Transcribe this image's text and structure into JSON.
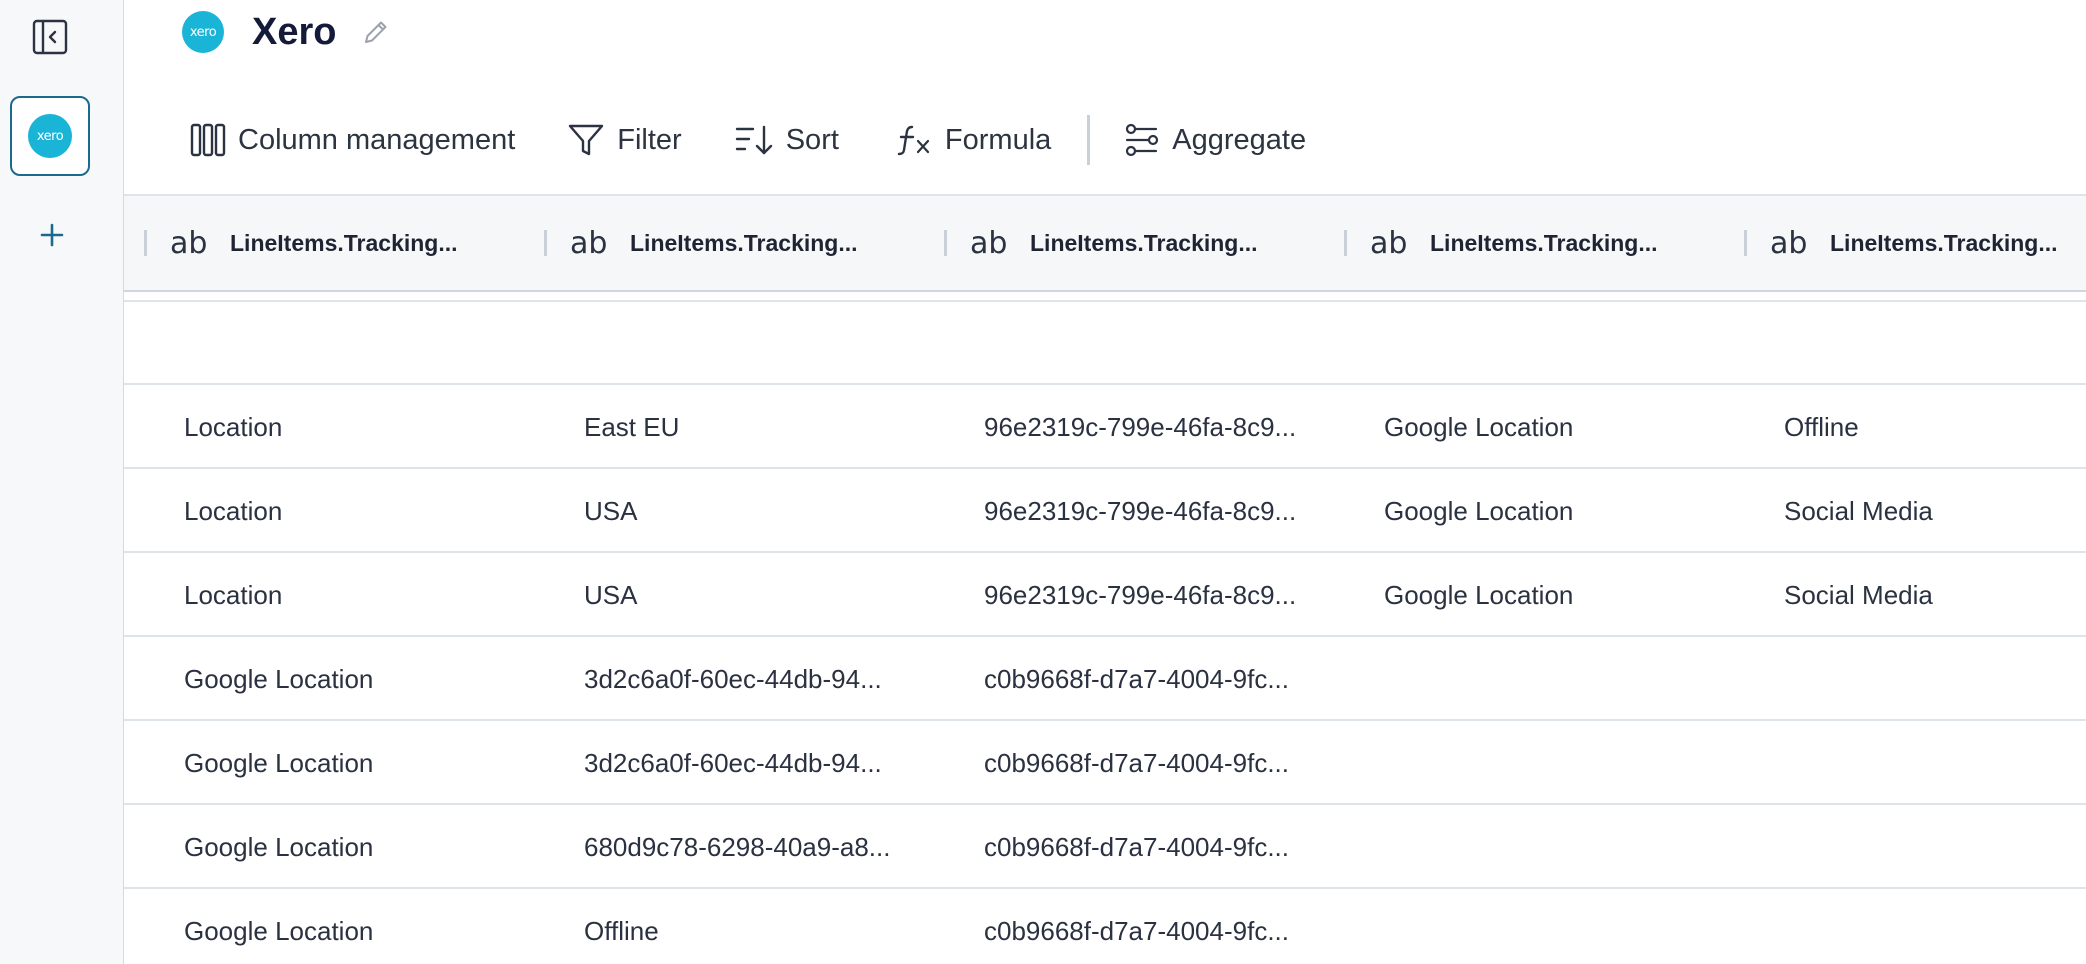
{
  "app": {
    "title": "Xero",
    "logo_text": "xero"
  },
  "sidebar": {
    "source_logo_text": "xero"
  },
  "toolbar": {
    "column_management": "Column management",
    "filter": "Filter",
    "sort": "Sort",
    "formula": "Formula",
    "aggregate": "Aggregate"
  },
  "table": {
    "type_icon_text": "ab",
    "headers": [
      "LineItems.Tracking...",
      "LineItems.Tracking...",
      "LineItems.Tracking...",
      "LineItems.Tracking...",
      "LineItems.Tracking..."
    ],
    "rows": [
      [
        "",
        "",
        "",
        "",
        ""
      ],
      [
        "Location",
        "East EU",
        "96e2319c-799e-46fa-8c9...",
        "Google Location",
        "Offline"
      ],
      [
        "Location",
        "USA",
        "96e2319c-799e-46fa-8c9...",
        "Google Location",
        "Social Media"
      ],
      [
        "Location",
        "USA",
        "96e2319c-799e-46fa-8c9...",
        "Google Location",
        "Social Media"
      ],
      [
        "Google Location",
        "3d2c6a0f-60ec-44db-94...",
        "c0b9668f-d7a7-4004-9fc...",
        "",
        ""
      ],
      [
        "Google Location",
        "3d2c6a0f-60ec-44db-94...",
        "c0b9668f-d7a7-4004-9fc...",
        "",
        ""
      ],
      [
        "Google Location",
        "680d9c78-6298-40a9-a8...",
        "c0b9668f-d7a7-4004-9fc...",
        "",
        ""
      ],
      [
        "Google Location",
        "Offline",
        "c0b9668f-d7a7-4004-9fc...",
        "",
        ""
      ]
    ]
  },
  "colors": {
    "accent": "#1b6a8e",
    "xero_brand": "#1ab4d7"
  }
}
